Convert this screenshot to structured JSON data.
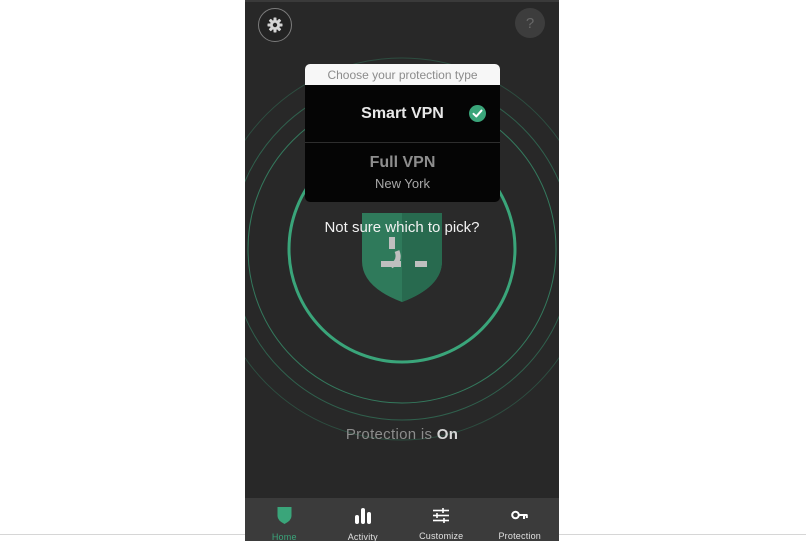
{
  "colors": {
    "accent": "#3aa57a",
    "background": "#282828",
    "tabbar": "#3b3b3b"
  },
  "header": {
    "settings_icon": "gear-icon",
    "help_label": "?"
  },
  "protection_picker": {
    "title": "Choose your protection type",
    "options": [
      {
        "title": "Smart VPN",
        "selected": true,
        "icon": "check-circle-icon"
      },
      {
        "title": "Full VPN",
        "subtitle": "New York",
        "selected": false
      }
    ],
    "help_link": "Not sure which to pick?"
  },
  "status": {
    "prefix": "Protection is",
    "state": "On"
  },
  "tabbar": {
    "tabs": [
      {
        "label": "Home",
        "icon": "shield-icon",
        "active": true
      },
      {
        "label": "Activity",
        "icon": "bar-chart-icon",
        "active": false
      },
      {
        "label": "Customize",
        "icon": "sliders-icon",
        "active": false
      },
      {
        "label": "Protection",
        "icon": "key-icon",
        "active": false
      }
    ]
  }
}
